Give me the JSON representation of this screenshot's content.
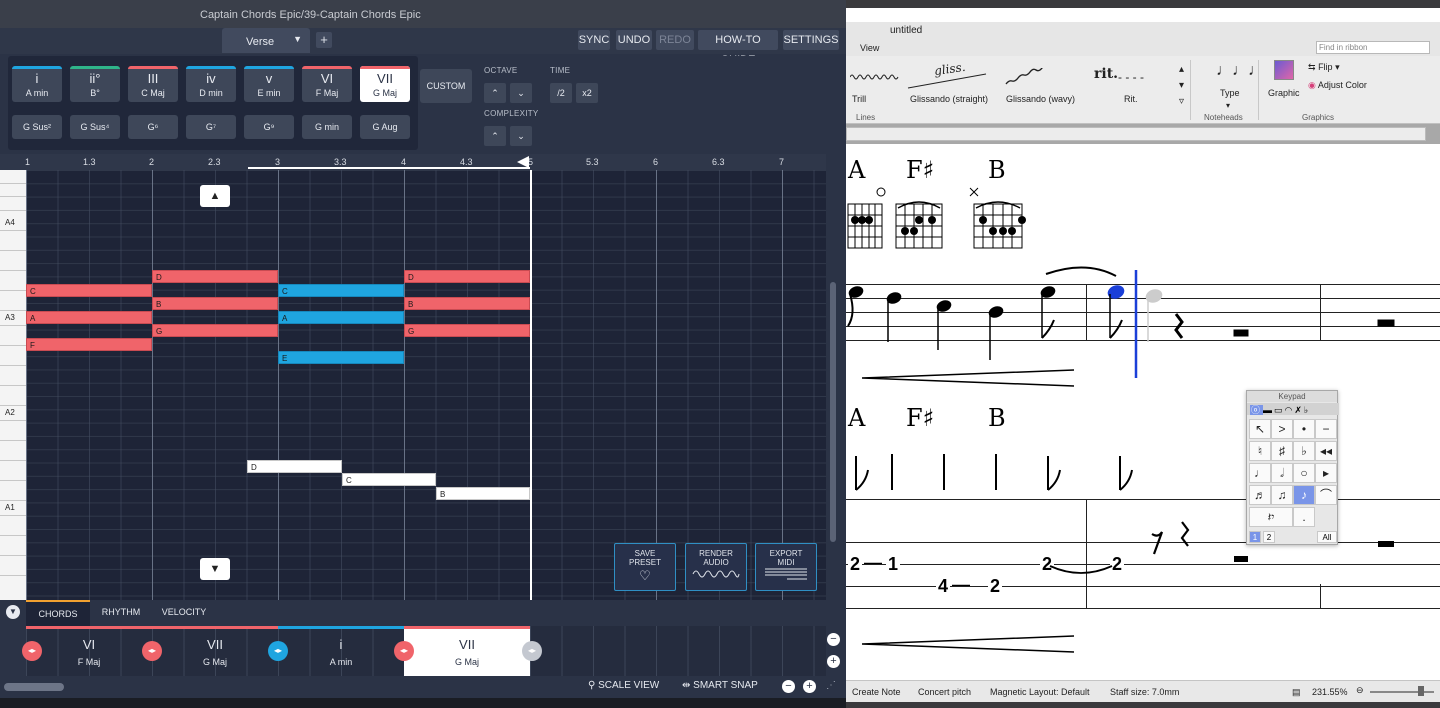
{
  "captain": {
    "title": "Captain Chords Epic/39-Captain Chords Epic",
    "section": "Verse",
    "add_label": "+",
    "toolbar": {
      "sync": "SYNC",
      "undo": "UNDO",
      "redo": "REDO",
      "howto": "HOW-TO GUIDE",
      "settings": "SETTINGS"
    },
    "chords": [
      {
        "roman": "i",
        "name": "A min",
        "color": "#1fa5e0"
      },
      {
        "roman": "ii°",
        "name": "B°",
        "color": "#2fb58a"
      },
      {
        "roman": "III",
        "name": "C Maj",
        "color": "#f0646a"
      },
      {
        "roman": "iv",
        "name": "D min",
        "color": "#1fa5e0"
      },
      {
        "roman": "v",
        "name": "E min",
        "color": "#1fa5e0"
      },
      {
        "roman": "VI",
        "name": "F Maj",
        "color": "#f0646a"
      },
      {
        "roman": "VII",
        "name": "G Maj",
        "color": "#f0646a"
      }
    ],
    "extensions": [
      "G Sus²",
      "G Sus⁴",
      "G⁶",
      "G⁷",
      "G⁹",
      "G min",
      "G Aug"
    ],
    "custom": "CUSTOM",
    "octave": "OCTAVE",
    "time": "TIME",
    "complexity": "COMPLEXITY",
    "time_half": "/2",
    "time_double": "x2",
    "up": "⌃",
    "down": "⌄",
    "timeline": [
      "1",
      "1.3",
      "2",
      "2.3",
      "3",
      "3.3",
      "4",
      "4.3",
      "5",
      "5.3",
      "6",
      "6.3",
      "7"
    ],
    "piano_labels": [
      "A4",
      "A3",
      "A2",
      "A1"
    ],
    "notes": [
      {
        "label": "D",
        "color": "red"
      },
      {
        "label": "C",
        "color": "red"
      },
      {
        "label": "B",
        "color": "red"
      },
      {
        "label": "A",
        "color": "red"
      },
      {
        "label": "G",
        "color": "red"
      },
      {
        "label": "F",
        "color": "red"
      },
      {
        "label": "C",
        "color": "blue"
      },
      {
        "label": "A",
        "color": "blue"
      },
      {
        "label": "E",
        "color": "blue"
      },
      {
        "label": "D",
        "color": "red"
      },
      {
        "label": "B",
        "color": "red"
      },
      {
        "label": "G",
        "color": "red"
      },
      {
        "label": "D",
        "color": "white"
      },
      {
        "label": "C",
        "color": "white"
      },
      {
        "label": "B",
        "color": "white"
      }
    ],
    "actions": {
      "save1": "SAVE",
      "save2": "PRESET",
      "render1": "RENDER",
      "render2": "AUDIO",
      "export1": "EXPORT",
      "export2": "MIDI"
    },
    "tabs": [
      "CHORDS",
      "RHYTHM",
      "VELOCITY"
    ],
    "track": [
      {
        "roman": "VI",
        "name": "F Maj"
      },
      {
        "roman": "VII",
        "name": "G Maj"
      },
      {
        "roman": "i",
        "name": "A min"
      },
      {
        "roman": "VII",
        "name": "G Maj"
      }
    ],
    "bottom": {
      "scale": "SCALE VIEW",
      "snap": "SMART SNAP",
      "minus": "−",
      "plus": "+"
    }
  },
  "sibelius": {
    "title": "untitled",
    "menu": "View",
    "search_placeholder": "Find in ribbon",
    "ribbon": {
      "trill": "Trill",
      "gliss_label": "gliss.",
      "gliss_straight": "Glissando (straight)",
      "gliss_wavy": "Glissando (wavy)",
      "rit_mark": "rit.",
      "rit": "Rit.",
      "type": "Type",
      "graphic": "Graphic",
      "flip": "Flip",
      "adjust_color": "Adjust Color",
      "group_lines": "Lines",
      "group_noteheads": "Noteheads",
      "group_graphics": "Graphics"
    },
    "chord_symbols": [
      "A",
      "F♯",
      "B"
    ],
    "tab_numbers": [
      "2",
      "1",
      "4",
      "2",
      "2",
      "2"
    ],
    "keypad": {
      "title": "Keypad",
      "tab1": "1",
      "tab2": "2",
      "all": "All"
    },
    "status": {
      "create_note": "Create Note",
      "concert_pitch": "Concert pitch",
      "magnetic": "Magnetic Layout: Default",
      "staff_size": "Staff size: 7.0mm",
      "zoom": "231.55%"
    }
  }
}
